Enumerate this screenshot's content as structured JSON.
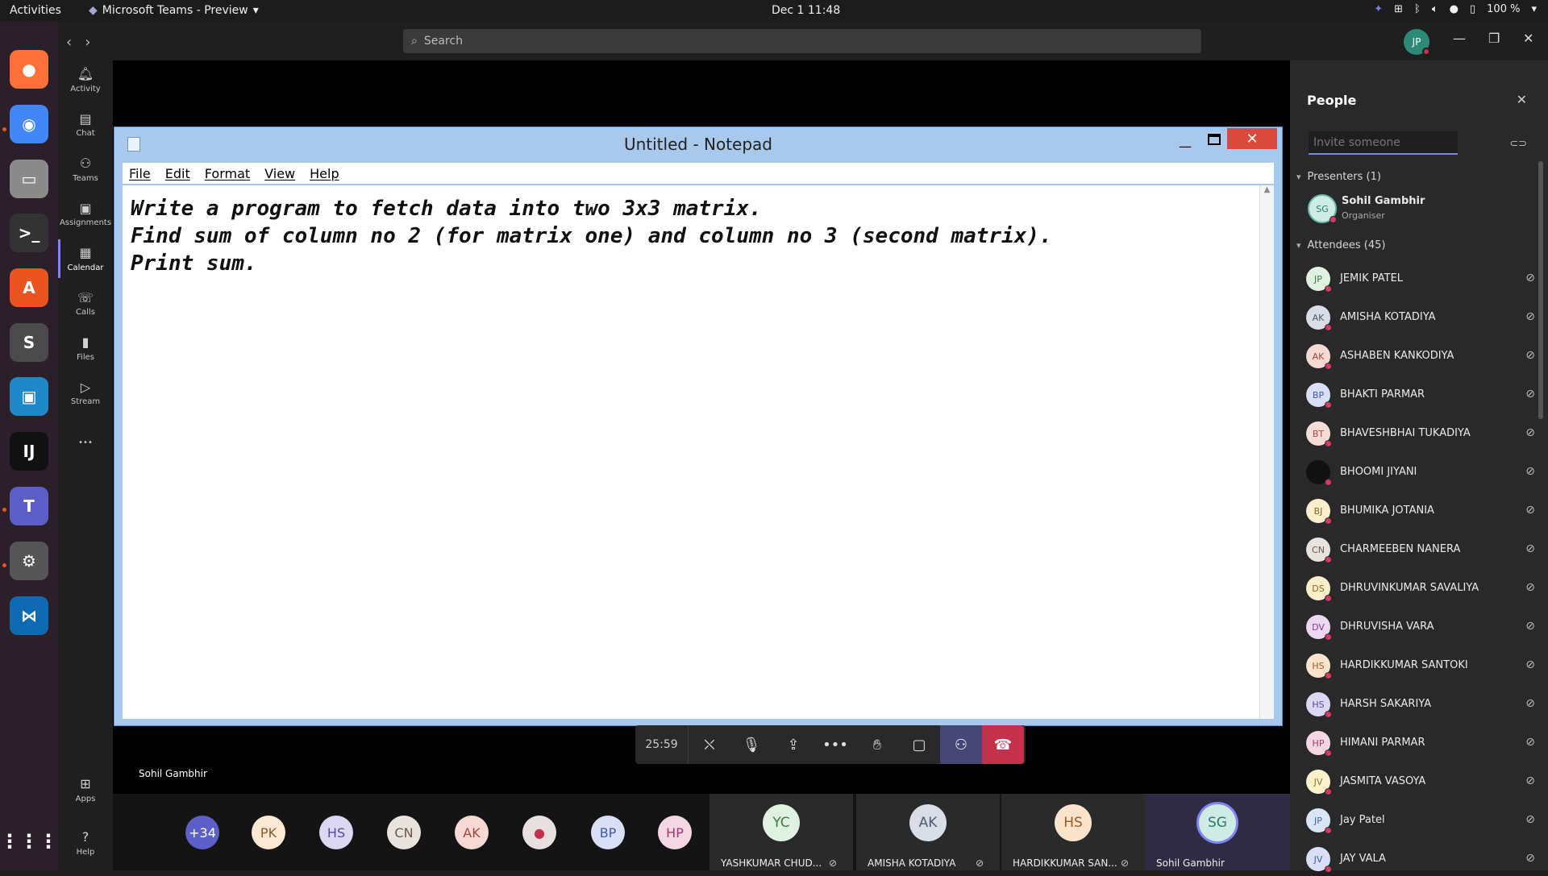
{
  "topbar": {
    "activities": "Activities",
    "app_menu": "Microsoft Teams - Preview",
    "clock": "Dec 1  11:48",
    "battery": "100 %"
  },
  "dock": {
    "apps": [
      {
        "name": "firefox-icon",
        "bg": "#ff7139",
        "glyph": "●"
      },
      {
        "name": "chrome-icon",
        "bg": "#4285f4",
        "glyph": "◉"
      },
      {
        "name": "files-icon",
        "bg": "#8a8a8a",
        "glyph": "▭"
      },
      {
        "name": "terminal-icon",
        "bg": "#333",
        "glyph": ">_"
      },
      {
        "name": "software-icon",
        "bg": "#e95420",
        "glyph": "A"
      },
      {
        "name": "sublime-icon",
        "bg": "#4b4b4b",
        "glyph": "S"
      },
      {
        "name": "remote-icon",
        "bg": "#1e88c8",
        "glyph": "▣"
      },
      {
        "name": "intellij-icon",
        "bg": "#111",
        "glyph": "IJ"
      },
      {
        "name": "teams-icon",
        "bg": "#5b5fc7",
        "glyph": "T"
      },
      {
        "name": "settings-icon",
        "bg": "#555",
        "glyph": "⚙"
      },
      {
        "name": "vscode-icon",
        "bg": "#0f6ab4",
        "glyph": "⋈"
      }
    ]
  },
  "rail": {
    "items": [
      {
        "label": "Activity",
        "icon": "bell-icon"
      },
      {
        "label": "Chat",
        "icon": "chat-icon"
      },
      {
        "label": "Teams",
        "icon": "teams-icon"
      },
      {
        "label": "Assignments",
        "icon": "assignments-icon"
      },
      {
        "label": "Calendar",
        "icon": "calendar-icon"
      },
      {
        "label": "Calls",
        "icon": "phone-icon"
      },
      {
        "label": "Files",
        "icon": "file-icon"
      },
      {
        "label": "Stream",
        "icon": "stream-icon"
      }
    ],
    "apps_label": "Apps",
    "help_label": "Help"
  },
  "header": {
    "search_placeholder": "Search",
    "user_initials": "JP"
  },
  "notepad": {
    "title": "Untitled - Notepad",
    "menu": [
      "File",
      "Edit",
      "Format",
      "View",
      "Help"
    ],
    "lines": [
      "Write a program to fetch data into two 3x3 matrix.",
      "Find sum of column no 2 (for matrix one) and column no 3 (second matrix).",
      "Print sum."
    ]
  },
  "stage": {
    "presenter_name": "Sohil Gambhir",
    "timer": "25:59"
  },
  "strip": {
    "bubbles": [
      {
        "label": "+34",
        "bg": "#5b5fc7",
        "fg": "#ffffff"
      },
      {
        "label": "PK",
        "bg": "#fce9d4",
        "fg": "#8a5a2b"
      },
      {
        "label": "HS",
        "bg": "#dcd7f2",
        "fg": "#5a4a9c"
      },
      {
        "label": "CN",
        "bg": "#e9e3de",
        "fg": "#6b5648"
      },
      {
        "label": "AK",
        "bg": "#f6d9d3",
        "fg": "#a4483a"
      },
      {
        "label": "",
        "bg": "#e8e0e0",
        "fg": "#c4314b"
      },
      {
        "label": "BP",
        "bg": "#d8dff6",
        "fg": "#3f5aa8"
      },
      {
        "label": "HP",
        "bg": "#f4d7e3",
        "fg": "#a33a6c"
      }
    ],
    "tiles": [
      {
        "initials": "YC",
        "name": "YASHKUMAR CHUD...",
        "bg": "#dff1e0",
        "fg": "#3f7a45"
      },
      {
        "initials": "AK",
        "name": "AMISHA KOTADIYA",
        "bg": "#d8dde6",
        "fg": "#4a5a72"
      },
      {
        "initials": "HS",
        "name": "HARDIKKUMAR SAN...",
        "bg": "#fbe3cc",
        "fg": "#9a5b24"
      },
      {
        "initials": "SG",
        "name": "Sohil Gambhir",
        "bg": "#cfece4",
        "fg": "#2d7a66"
      }
    ]
  },
  "people": {
    "title": "People",
    "invite_placeholder": "Invite someone",
    "presenters_label": "Presenters (1)",
    "presenter": {
      "initials": "SG",
      "name": "Sohil Gambhir",
      "role": "Organiser"
    },
    "attendees_label": "Attendees (45)",
    "attendees": [
      {
        "initials": "JP",
        "name": "JEMIK PATEL",
        "bg": "#dff1e0",
        "fg": "#3f7a45"
      },
      {
        "initials": "AK",
        "name": "AMISHA KOTADIYA",
        "bg": "#d8dde6",
        "fg": "#4a5a72"
      },
      {
        "initials": "AK",
        "name": "ASHABEN KANKODIYA",
        "bg": "#f6d9d3",
        "fg": "#a4483a"
      },
      {
        "initials": "BP",
        "name": "BHAKTI PARMAR",
        "bg": "#d8dff6",
        "fg": "#3f5aa8"
      },
      {
        "initials": "BT",
        "name": "BHAVESHBHAI TUKADIYA",
        "bg": "#f8dcd8",
        "fg": "#b04a3c"
      },
      {
        "initials": "",
        "name": "BHOOMI JIYANI",
        "bg": "#111111",
        "fg": "#ffffff"
      },
      {
        "initials": "BJ",
        "name": "BHUMIKA JOTANIA",
        "bg": "#fbeecb",
        "fg": "#8a6a1c"
      },
      {
        "initials": "CN",
        "name": "CHARMEEBEN NANERA",
        "bg": "#e9e3de",
        "fg": "#6b5648"
      },
      {
        "initials": "DS",
        "name": "DHRUVINKUMAR SAVALIYA",
        "bg": "#fbeecb",
        "fg": "#8a6a1c"
      },
      {
        "initials": "DV",
        "name": "DHRUVISHA VARA",
        "bg": "#ecd8f1",
        "fg": "#7a3c8e"
      },
      {
        "initials": "HS",
        "name": "HARDIKKUMAR SANTOKI",
        "bg": "#fbe3cc",
        "fg": "#9a5b24"
      },
      {
        "initials": "HS",
        "name": "HARSH SAKARIYA",
        "bg": "#dcd7f2",
        "fg": "#5a4a9c"
      },
      {
        "initials": "HP",
        "name": "HIMANI PARMAR",
        "bg": "#f4d7e3",
        "fg": "#a33a6c"
      },
      {
        "initials": "JV",
        "name": "JASMITA VASOYA",
        "bg": "#fbf1cb",
        "fg": "#8a7a1c"
      },
      {
        "initials": "JP",
        "name": "Jay Patel",
        "bg": "#d8e6f6",
        "fg": "#3f68a8"
      },
      {
        "initials": "JV",
        "name": "JAY VALA",
        "bg": "#d8dff6",
        "fg": "#3f5aa8"
      }
    ]
  }
}
